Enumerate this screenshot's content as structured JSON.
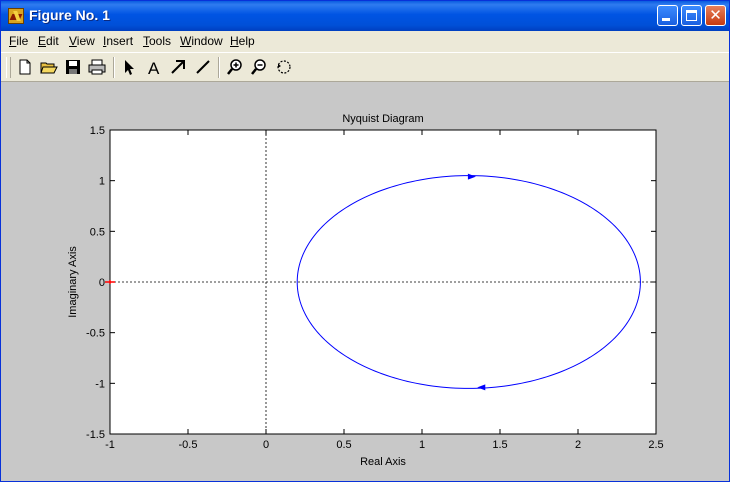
{
  "window": {
    "title": "Figure No. 1"
  },
  "menu": {
    "items": [
      {
        "label": "File",
        "accel": "F",
        "rest": "ile"
      },
      {
        "label": "Edit",
        "accel": "E",
        "rest": "dit"
      },
      {
        "label": "View",
        "accel": "V",
        "rest": "iew"
      },
      {
        "label": "Insert",
        "accel": "I",
        "rest": "nsert"
      },
      {
        "label": "Tools",
        "accel": "T",
        "rest": "ools"
      },
      {
        "label": "Window",
        "accel": "W",
        "rest": "indow"
      },
      {
        "label": "Help",
        "accel": "H",
        "rest": "elp"
      }
    ]
  },
  "toolbar": {
    "tools": [
      "new-file-icon",
      "open-folder-icon",
      "save-icon",
      "print-icon",
      "select-arrow-icon",
      "insert-text-icon",
      "insert-arrow-icon",
      "insert-line-icon",
      "zoom-in-icon",
      "zoom-out-icon",
      "rotate-icon"
    ]
  },
  "colors": {
    "curve": "#0000ff",
    "critical_point": "#ff0000",
    "figure_bg": "#c8c8c8",
    "axes_bg": "#ffffff"
  },
  "chart_data": {
    "type": "line",
    "title": "Nyquist Diagram",
    "xlabel": "Real Axis",
    "ylabel": "Imaginary Axis",
    "xlim": [
      -1,
      2.5
    ],
    "ylim": [
      -1.5,
      1.5
    ],
    "xticks": [
      -1,
      -0.5,
      0,
      0.5,
      1,
      1.5,
      2,
      2.5
    ],
    "xtick_labels": [
      "-1",
      "-0.5",
      "0",
      "0.5",
      "1",
      "1.5",
      "2",
      "2.5"
    ],
    "yticks": [
      -1.5,
      -1,
      -0.5,
      0,
      0.5,
      1,
      1.5
    ],
    "ytick_labels": [
      "-1.5",
      "-1",
      "-0.5",
      "0",
      "0.5",
      "1",
      "1.5"
    ],
    "grid": false,
    "series": [
      {
        "center": [
          1.3,
          0
        ],
        "radius_x": 1.1,
        "radius_y": 1.05
      }
    ],
    "arrows": [
      {
        "x": 1.32,
        "y": 1.04,
        "direction": "right"
      },
      {
        "x": 1.38,
        "y": -1.04,
        "direction": "left"
      }
    ],
    "critical_point": [
      -1,
      0
    ]
  }
}
